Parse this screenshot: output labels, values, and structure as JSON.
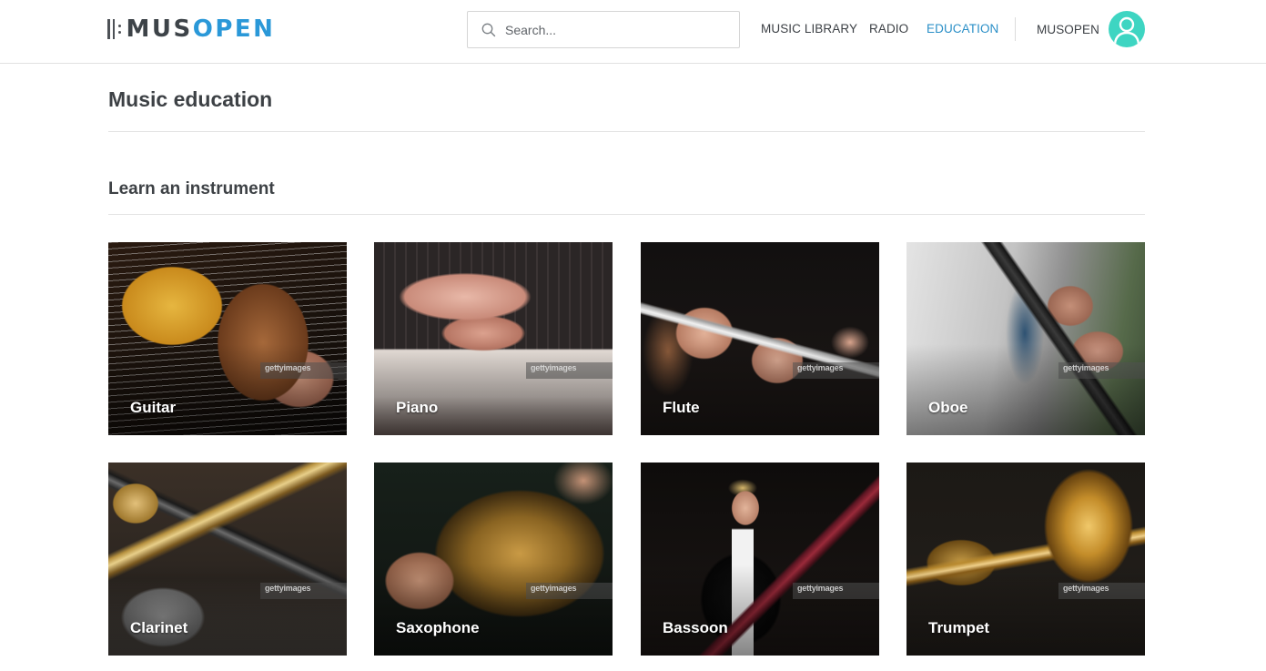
{
  "header": {
    "logo": {
      "part1": "MUS",
      "part2": "OPEN"
    },
    "search": {
      "placeholder": "Search...",
      "value": ""
    },
    "nav": [
      {
        "label": "MUSIC LIBRARY"
      },
      {
        "label": "RADIO"
      },
      {
        "label": "EDUCATION"
      }
    ],
    "user_label": "MUSOPEN"
  },
  "colors": {
    "accent": "#2a98d8",
    "active_nav": "#2a8fc7",
    "avatar": "#3ed5c2",
    "text": "#3d4145"
  },
  "page": {
    "title": "Music education",
    "section_title": "Learn an instrument"
  },
  "instruments": [
    {
      "label": "Guitar",
      "watermark": "gettyimages"
    },
    {
      "label": "Piano",
      "watermark": "gettyimages"
    },
    {
      "label": "Flute",
      "watermark": "gettyimages"
    },
    {
      "label": "Oboe",
      "watermark": "gettyimages"
    },
    {
      "label": "Clarinet",
      "watermark": "gettyimages"
    },
    {
      "label": "Saxophone",
      "watermark": "gettyimages"
    },
    {
      "label": "Bassoon",
      "watermark": "gettyimages"
    },
    {
      "label": "Trumpet",
      "watermark": "gettyimages"
    }
  ],
  "icons": {
    "search": "search-icon",
    "avatar": "user-avatar-icon",
    "logo": "musopen-logo-icon"
  }
}
